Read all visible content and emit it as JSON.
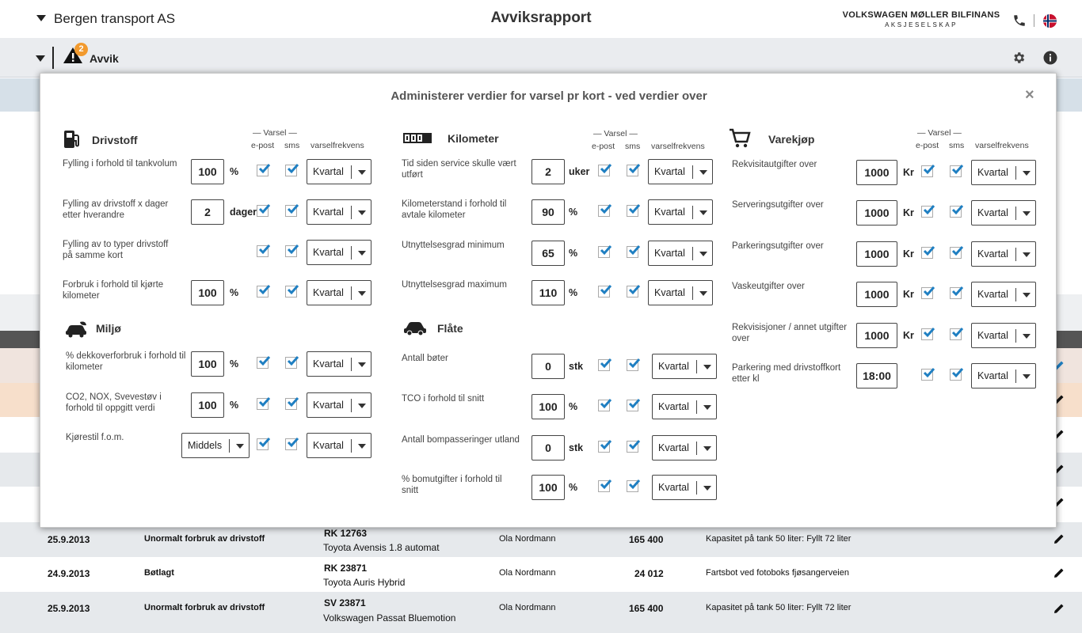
{
  "header": {
    "company": "Bergen transport AS",
    "title": "Avviksrapport",
    "brand_line1": "VOLKSWAGEN MØLLER BILFINANS",
    "brand_line2": "AKSJESELSKAP"
  },
  "subbar": {
    "avvik_label": "Avvik",
    "badge_count": "2"
  },
  "modal": {
    "title": "Administerer verdier for varsel pr kort - ved verdier over",
    "close": "×",
    "col_headers": {
      "varsel": "Varsel",
      "epost": "e-post",
      "sms": "sms",
      "frekvens": "varselfrekvens"
    },
    "drivstoff": {
      "title": "Drivstoff",
      "rows": [
        {
          "label": "Fylling i forhold til tankvolum",
          "value": "100",
          "unit": "%",
          "freq": "Kvartal"
        },
        {
          "label": "Fylling av drivstoff x dager etter hverandre",
          "value": "2",
          "unit": "dager",
          "freq": "Kvartal"
        },
        {
          "label": "Fylling av to typer drivstoff på samme kort",
          "value": "",
          "unit": "",
          "freq": "Kvartal"
        },
        {
          "label": "Forbruk i forhold til kjørte kilometer",
          "value": "100",
          "unit": "%",
          "freq": "Kvartal"
        }
      ]
    },
    "miljo": {
      "title": "Miljø",
      "rows": [
        {
          "label": "% dekkoverforbruk i forhold til kilometer",
          "value": "100",
          "unit": "%",
          "freq": "Kvartal"
        },
        {
          "label": "CO2, NOX, Svevestøv i forhold til oppgitt verdi",
          "value": "100",
          "unit": "%",
          "freq": "Kvartal"
        },
        {
          "label": "Kjørestil f.o.m.",
          "value": "Middels",
          "unit": "",
          "freq": "Kvartal"
        }
      ]
    },
    "kilometer": {
      "title": "Kilometer",
      "rows": [
        {
          "label": "Tid siden service skulle vært utført",
          "value": "2",
          "unit": "uker",
          "freq": "Kvartal"
        },
        {
          "label": "Kilometerstand i forhold til avtale kilometer",
          "value": "90",
          "unit": "%",
          "freq": "Kvartal"
        },
        {
          "label": "Utnyttelsesgrad minimum",
          "value": "65",
          "unit": "%",
          "freq": "Kvartal"
        },
        {
          "label": "Utnyttelsesgrad maximum",
          "value": "110",
          "unit": "%",
          "freq": "Kvartal"
        }
      ]
    },
    "flate": {
      "title": "Flåte",
      "rows": [
        {
          "label": "Antall bøter",
          "value": "0",
          "unit": "stk",
          "freq": "Kvartal"
        },
        {
          "label": "TCO i forhold til snitt",
          "value": "100",
          "unit": "%",
          "freq": "Kvartal"
        },
        {
          "label": "Antall bompasseringer utland",
          "value": "0",
          "unit": "stk",
          "freq": "Kvartal"
        },
        {
          "label": "% bomutgifter i forhold til snitt",
          "value": "100",
          "unit": "%",
          "freq": "Kvartal"
        }
      ]
    },
    "varekjop": {
      "title": "Varekjøp",
      "rows": [
        {
          "label": "Rekvisitautgifter over",
          "value": "1000",
          "unit": "Kr",
          "freq": "Kvartal"
        },
        {
          "label": "Serveringsutgifter over",
          "value": "1000",
          "unit": "Kr",
          "freq": "Kvartal"
        },
        {
          "label": "Parkeringsutgifter over",
          "value": "1000",
          "unit": "Kr",
          "freq": "Kvartal"
        },
        {
          "label": "Vaskeutgifter over",
          "value": "1000",
          "unit": "Kr",
          "freq": "Kvartal"
        },
        {
          "label": "Rekvisisjoner / annet utgifter over",
          "value": "1000",
          "unit": "Kr",
          "freq": "Kvartal"
        },
        {
          "label": "Parkering med drivstoffkort etter kl",
          "value": "18:00",
          "unit": "",
          "freq": "Kvartal"
        }
      ]
    }
  },
  "table": {
    "rows": [
      {
        "date": "25.9.2013",
        "type": "Unormalt forbruk av drivstoff",
        "reg": "RK 12763",
        "car": "Toyota Avensis 1.8 automat",
        "driver": "Ola Nordmann",
        "km": "165 400",
        "comment": "Kapasitet på tank 50 liter: Fyllt 72 liter"
      },
      {
        "date": "24.9.2013",
        "type": "Bøtlagt",
        "reg": "RK 23871",
        "car": "Toyota Auris Hybrid",
        "driver": "Ola Nordmann",
        "km": "24 012",
        "comment": "Fartsbot ved fotoboks fjøsangerveien"
      },
      {
        "date": "25.9.2013",
        "type": "Unormalt forbruk av drivstoff",
        "reg": "SV 23871",
        "car": "Volkswagen Passat Bluemotion",
        "driver": "Ola Nordmann",
        "km": "165 400",
        "comment": "Kapasitet på tank 50 liter: Fyllt 72 liter"
      }
    ]
  },
  "colors": {
    "accent": "#1f7fc2",
    "badge": "#f29a2e",
    "flag": "#c8102e",
    "header_bar": "#555555"
  }
}
